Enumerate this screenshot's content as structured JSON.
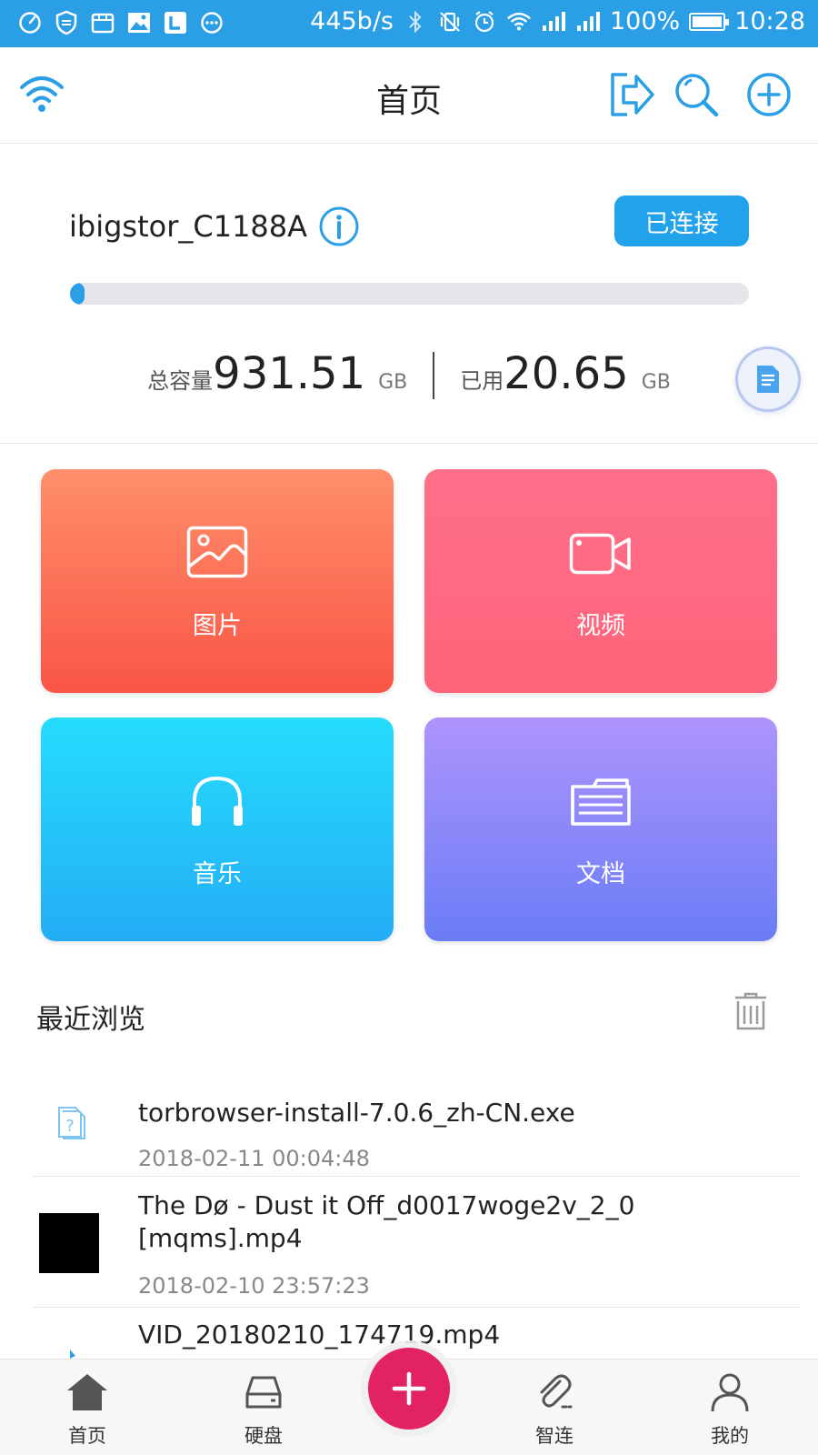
{
  "status_bar": {
    "net_speed": "445b/s",
    "battery": "100%",
    "time": "10:28"
  },
  "header": {
    "title": "首页"
  },
  "device": {
    "name": "ibigstor_C1188A",
    "status_button": "已连接",
    "usage_fraction": 0.022,
    "total_label": "总容量",
    "total_value": "931.51",
    "total_unit": "GB",
    "used_label": "已用",
    "used_value": "20.65",
    "used_unit": "GB"
  },
  "categories": [
    {
      "label": "图片",
      "icon": "image-icon"
    },
    {
      "label": "视频",
      "icon": "video-icon"
    },
    {
      "label": "音乐",
      "icon": "headphones-icon"
    },
    {
      "label": "文档",
      "icon": "folder-icon"
    }
  ],
  "recent": {
    "title": "最近浏览",
    "items": [
      {
        "name": "torbrowser-install-7.0.6_zh-CN.exe",
        "time": "2018-02-11 00:04:48",
        "icon": "unknown-file-icon"
      },
      {
        "name_line1": "The Dø - Dust it Off_d0017woge2v_2_0",
        "name_line2": "[mqms].mp4",
        "time": "2018-02-10 23:57:23",
        "icon": "video-thumbnail"
      },
      {
        "name": "VID_20180210_174719.mp4",
        "icon": "video-file-icon"
      }
    ]
  },
  "bottom_nav": {
    "items": [
      {
        "label": "首页",
        "icon": "home-icon"
      },
      {
        "label": "硬盘",
        "icon": "hard-drive-icon"
      },
      {
        "label": "智连",
        "icon": "paperclip-icon"
      },
      {
        "label": "我的",
        "icon": "person-icon"
      }
    ],
    "center_icon": "plus-icon"
  },
  "colors": {
    "accent": "#2b9fe6",
    "fab": "#e32262"
  }
}
